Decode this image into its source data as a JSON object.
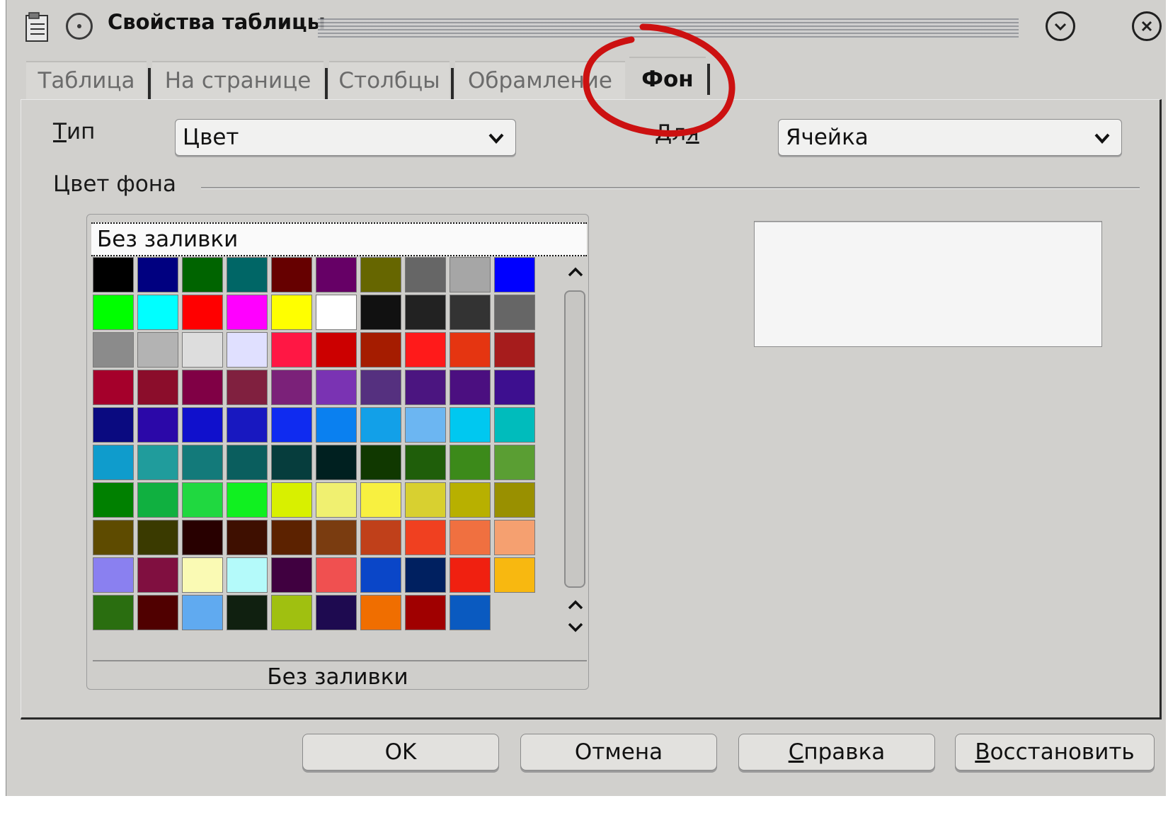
{
  "window": {
    "title": "Свойства таблицы"
  },
  "tabs": [
    {
      "label": "Таблица",
      "active": false
    },
    {
      "label": "На странице",
      "active": false
    },
    {
      "label": "Столбцы",
      "active": false
    },
    {
      "label": "Обрамление",
      "active": false
    },
    {
      "label": "Фон",
      "active": true
    }
  ],
  "type_field": {
    "label_first": "Т",
    "label_rest": "ип",
    "value": "Цвет"
  },
  "for_field": {
    "label_first": "Д",
    "label_mid": "л",
    "label_last": "я",
    "value": "Ячейка"
  },
  "group_title": "Цвет фона",
  "palette": {
    "no_fill_label": "Без заливки",
    "caption": "Без заливки",
    "colors": [
      "#000000",
      "#000080",
      "#006400",
      "#006666",
      "#660000",
      "#660066",
      "#666600",
      "#666666",
      "#a6a6a6",
      "#0000ff",
      "#00ff00",
      "#00ffff",
      "#ff0000",
      "#ff00ff",
      "#ffff00",
      "#ffffff",
      "#111111",
      "#222222",
      "#333333",
      "#666666",
      "#8b8b8b",
      "#b3b3b3",
      "#dddddd",
      "#e0e0ff",
      "#ff1744",
      "#cc0000",
      "#a51c00",
      "#ff1a1a",
      "#e53511",
      "#a61c1c",
      "#a5002b",
      "#8b0d2b",
      "#800045",
      "#80203f",
      "#7b2179",
      "#7a33b3",
      "#55307f",
      "#4b1580",
      "#4b0f80",
      "#3d0f8f",
      "#0a0a80",
      "#2b08a8",
      "#1010cc",
      "#1818c0",
      "#0f2bf0",
      "#0a80f0",
      "#12a0e8",
      "#6cb6f2",
      "#00c8f0",
      "#00bcbc",
      "#0f9ccc",
      "#209c9c",
      "#137a7a",
      "#0a5e5e",
      "#063d3d",
      "#002020",
      "#103800",
      "#1f5e0a",
      "#3c8a1a",
      "#5a9e33",
      "#008000",
      "#10b040",
      "#20d840",
      "#10f020",
      "#d8f000",
      "#f0f070",
      "#f8f040",
      "#d8d030",
      "#b8b000",
      "#999000",
      "#5e4b00",
      "#3a3a00",
      "#280000",
      "#3e0f00",
      "#5c2200",
      "#7a3c10",
      "#c0401a",
      "#f04020",
      "#f07040",
      "#f5a070",
      "#8a80f0",
      "#800f40",
      "#fafab4",
      "#b4fafa",
      "#400040",
      "#f05050",
      "#0a46c8",
      "#002060",
      "#f02010",
      "#f8b810",
      "#2a6e10",
      "#500000",
      "#60aaf0",
      "#102010",
      "#a0c010",
      "#1e0a50",
      "#f06e00",
      "#a00000",
      "#0a5ac0"
    ]
  },
  "buttons": {
    "ok": "OK",
    "cancel": "Отмена",
    "help_first": "С",
    "help_rest": "правка",
    "reset_first": "В",
    "reset_rest": "осстановить"
  },
  "annotation_color": "#cc1111"
}
